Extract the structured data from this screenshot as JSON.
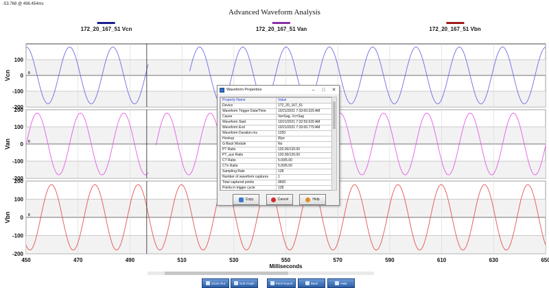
{
  "header": {
    "cursor_readout": "-53.768 @ 496.454ms",
    "title": "Advanced Waveform Analysis"
  },
  "legend": [
    {
      "label": "172_20_167_51 Vcn",
      "color": "#1a1f8f"
    },
    {
      "label": "172_20_167_51 Van",
      "color": "#8c2fa8"
    },
    {
      "label": "172_20_167_51 Vbn",
      "color": "#a01818"
    }
  ],
  "chart_data": {
    "type": "line",
    "xlabel": "Milliseconds",
    "xlim": [
      450,
      650
    ],
    "x_ticks": [
      "450",
      "470",
      "490",
      "510",
      "530",
      "550",
      "570",
      "590",
      "610",
      "630",
      "650"
    ],
    "cursor_x": 496.454,
    "grid": true,
    "panels": [
      {
        "ylabel": "Vcn",
        "ylim": [
          -200,
          200
        ],
        "y_ticks": [
          "100",
          "0",
          "-100",
          "-200"
        ],
        "color": "#6a6ae6",
        "series": {
          "amplitude": 180,
          "period_ms": 16.67,
          "phase_deg": 90
        },
        "sag": {
          "start_ms": 497,
          "end_ms": 513,
          "value": 0
        }
      },
      {
        "ylabel": "Van",
        "ylim": [
          -200,
          200
        ],
        "y_ticks": [
          "200",
          "100",
          "0",
          "-100",
          "-200"
        ],
        "color": "#e65ae6",
        "series": {
          "amplitude": 180,
          "period_ms": 16.67,
          "phase_deg": 0
        },
        "sag": {
          "start_ms": 497,
          "end_ms": 500,
          "value": 0
        }
      },
      {
        "ylabel": "Vbn",
        "ylim": [
          -200,
          200
        ],
        "y_ticks": [
          "200",
          "100",
          "0",
          "-100",
          "-200"
        ],
        "color": "#e65050",
        "series": {
          "amplitude": 180,
          "period_ms": 16.67,
          "phase_deg": 240
        }
      }
    ]
  },
  "dialog": {
    "title": "Waveform Properties",
    "controls": {
      "minimize": "–",
      "maximize": "□",
      "close": "✕"
    },
    "columns": [
      "Property Name",
      "Value"
    ],
    "rows": [
      [
        "Device",
        "172_20_167_51"
      ],
      [
        "Waveform Trigger Date/Time",
        "10/21/2021 7:33:00.029 AM"
      ],
      [
        "Cause",
        "Va=Sag, Vc=Sag"
      ],
      [
        "Waveform Start",
        "10/21/2021 7:32:59.529 AM"
      ],
      [
        "Waveform End",
        "10/21/2021 7:33:00.779 AM"
      ],
      [
        "Waveform Duration ms",
        "1250"
      ],
      [
        "Hookup",
        "Wye"
      ],
      [
        "G-Back Module",
        "No"
      ],
      [
        "PT Ratio",
        "120.00/120.00"
      ],
      [
        "PT_aux Ratio",
        "120.00/120.00"
      ],
      [
        "CT Ratio",
        "5.00/5.00"
      ],
      [
        "CTn Ratio",
        "5.00/5.00"
      ],
      [
        "Sampling Rate",
        "128"
      ],
      [
        "Number of waveform captures",
        "1"
      ],
      [
        "Total captured points",
        "9600"
      ],
      [
        "Points in trigger cycle",
        "128"
      ]
    ],
    "buttons": {
      "copy": "Copy",
      "cancel": "Cancel",
      "help": "Help"
    }
  },
  "footer": {
    "buttons": {
      "zoom_out": "Zoom Out",
      "edit_graph": "Edit Graph",
      "print_export": "Print/ Export",
      "back": "Back",
      "help": "Help"
    }
  }
}
